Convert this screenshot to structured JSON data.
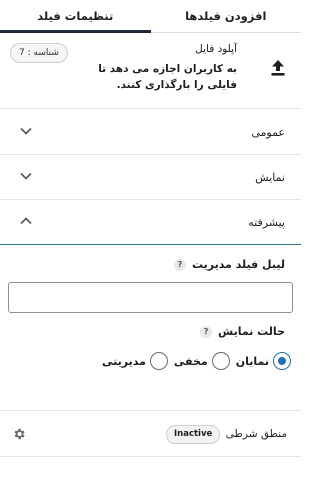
{
  "tabs": [
    {
      "label": "افزودن فیلدها"
    },
    {
      "label": "تنظیمات فیلد"
    }
  ],
  "field": {
    "title": "آپلود فایل",
    "description": "به کاربران اجازه می دهد تا فایلی را بارگذاری کنند.",
    "id_badge": "شناسه : 7",
    "icon": "upload-icon"
  },
  "sections": [
    {
      "label": "عمومی",
      "state": "collapsed"
    },
    {
      "label": "نمایش",
      "state": "collapsed"
    },
    {
      "label": "پیشرفته",
      "state": "expanded"
    }
  ],
  "advanced": {
    "admin_label": "لیبل فیلد مدیریت",
    "admin_label_help": "?",
    "admin_label_value": "",
    "display_mode_label": "حالت نمایش",
    "display_mode_help": "?",
    "display_modes": [
      {
        "label": "نمایان",
        "checked": true
      },
      {
        "label": "مخفی",
        "checked": false
      },
      {
        "label": "مدیریتی",
        "checked": false
      }
    ]
  },
  "conditional": {
    "label": "منطق شرطی",
    "status": "Inactive",
    "icon": "gear-icon"
  },
  "colors": {
    "accent": "#2271b1",
    "tab_underline": "#1e2a3a",
    "open_section_border": "#2b7a8a"
  }
}
